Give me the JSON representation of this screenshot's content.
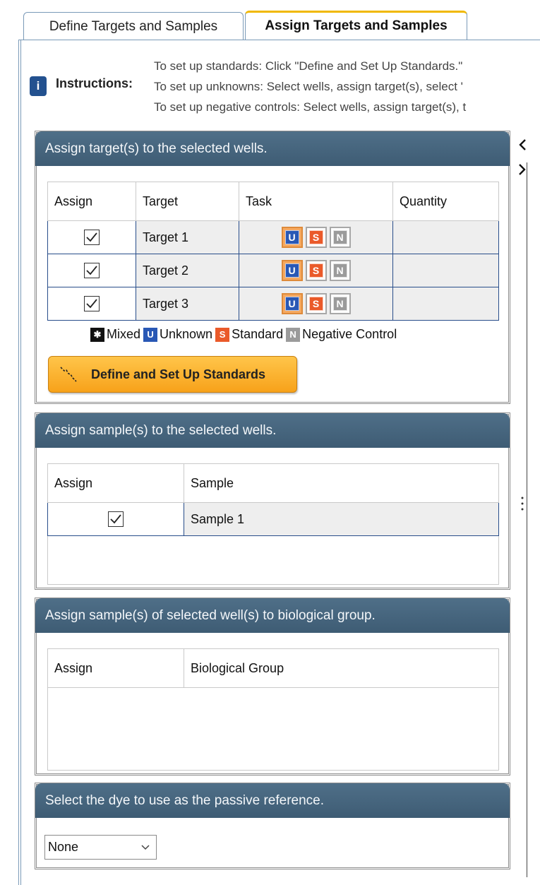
{
  "tabs": [
    {
      "label": "Define Targets and Samples"
    },
    {
      "label": "Assign Targets and Samples"
    }
  ],
  "instructions": {
    "icon": "info-icon",
    "label": "Instructions:",
    "lines": [
      "To set up standards: Click \"Define and Set Up Standards.\"",
      "To set up unknowns: Select wells, assign target(s), select '",
      "To set up negative controls: Select wells, assign target(s), t"
    ]
  },
  "targets_panel": {
    "title": "Assign target(s) to the selected wells.",
    "columns": [
      "Assign",
      "Target",
      "Task",
      "Quantity"
    ],
    "rows": [
      {
        "assigned": true,
        "target": "Target 1",
        "task": "U",
        "quantity": ""
      },
      {
        "assigned": true,
        "target": "Target 2",
        "task": "U",
        "quantity": ""
      },
      {
        "assigned": true,
        "target": "Target 3",
        "task": "U",
        "quantity": ""
      }
    ],
    "task_letters": {
      "u": "U",
      "s": "S",
      "n": "N"
    },
    "legend": {
      "mixed": "Mixed",
      "unknown": "Unknown",
      "standard": "Standard",
      "negative": "Negative Control"
    },
    "standards_button": "Define and Set Up Standards"
  },
  "samples_panel": {
    "title": "Assign sample(s) to the selected wells.",
    "columns": [
      "Assign",
      "Sample"
    ],
    "rows": [
      {
        "assigned": true,
        "sample": "Sample 1"
      }
    ]
  },
  "bio_panel": {
    "title": "Assign sample(s) of selected well(s) to biological group.",
    "columns": [
      "Assign",
      "Biological Group"
    ]
  },
  "dye_panel": {
    "title": "Select the dye to use as the passive reference.",
    "selected": "None"
  },
  "colors": {
    "panel_header": "#466680",
    "accent_tab": "#f0b800",
    "unknown": "#2958b5",
    "standard": "#ea5a2a",
    "negative": "#9b9b9b",
    "button": "#f7a21a"
  }
}
